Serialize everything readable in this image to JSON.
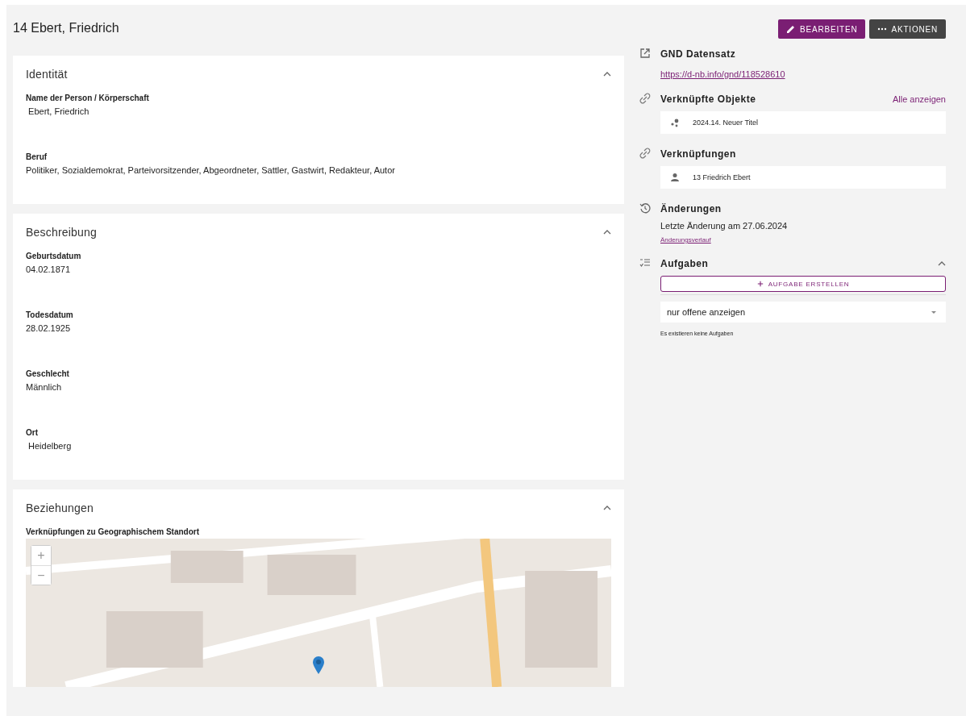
{
  "page_title": "14 Ebert, Friedrich",
  "actions": [
    {
      "kind": "edit",
      "label": "BEARBEITEN"
    },
    {
      "kind": "more",
      "label": "AKTIONEN"
    }
  ],
  "cards": [
    {
      "title": "Identität",
      "expanded": true,
      "fields": [
        {
          "label": "Name der Person / Körperschaft",
          "value": " Ebert, Friedrich"
        },
        {
          "label": "Beruf",
          "value": "Politiker, Sozialdemokrat, Parteivorsitzender, Abgeordneter, Sattler, Gastwirt, Redakteur, Autor"
        }
      ]
    },
    {
      "title": "Beschreibung",
      "expanded": true,
      "fields": [
        {
          "label": "Geburtsdatum",
          "value": "04.02.1871"
        },
        {
          "label": "Todesdatum",
          "value": "28.02.1925"
        },
        {
          "label": "Geschlecht",
          "value": "Männlich"
        },
        {
          "label": "Ort",
          "value": " Heidelberg"
        }
      ]
    },
    {
      "title": "Beziehungen",
      "expanded": true,
      "map_label": "Verknüpfungen zu Geographischem Standort",
      "map_controls": [
        "+",
        "−"
      ]
    }
  ],
  "side": [
    {
      "kind": "gnd",
      "title": "GND Datensatz",
      "url": "https://d-nb.info/gnd/118528610"
    },
    {
      "kind": "list",
      "title": "Verknüpfte Objekte",
      "action": "Alle anzeigen",
      "items": [
        {
          "kind": "object",
          "text": "2024.14. Neuer Titel"
        }
      ]
    },
    {
      "kind": "list",
      "title": "Verknüpfungen",
      "items": [
        {
          "kind": "person",
          "text": "13 Friedrich Ebert"
        }
      ]
    },
    {
      "kind": "changes",
      "title": "Änderungen",
      "text": "Letzte Änderung am 27.06.2024",
      "link": "Änderungsverlauf"
    },
    {
      "kind": "tasks",
      "title": "Aufgaben",
      "expanded": true,
      "create_label": "AUFGABE ERSTELLEN",
      "filter": "nur offene anzeigen",
      "empty": "Es existieren keine Aufgaben"
    }
  ]
}
